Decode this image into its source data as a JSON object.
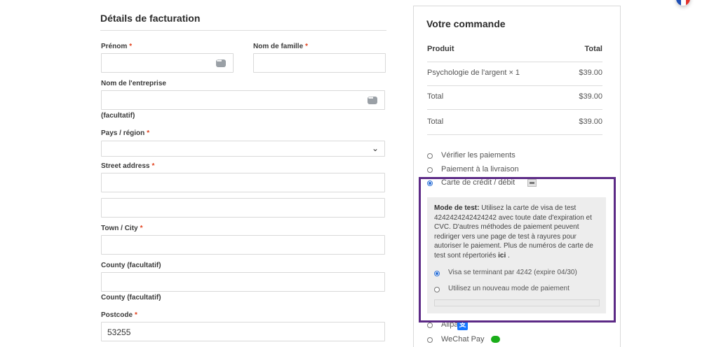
{
  "billing": {
    "title": "Détails de facturation",
    "required_mark": "*",
    "first_name": {
      "label": "Prénom",
      "value": ""
    },
    "last_name": {
      "label": "Nom de famille",
      "value": ""
    },
    "company": {
      "label": "Nom de l'entreprise",
      "hint": "(facultatif)",
      "value": ""
    },
    "country": {
      "label": "Pays / région",
      "value": ""
    },
    "street": {
      "label": "Street address",
      "value": "",
      "value2": ""
    },
    "town": {
      "label": "Town / City",
      "value": ""
    },
    "county": {
      "label": "County (facultatif)",
      "value": "",
      "hint": "County (facultatif)"
    },
    "postcode": {
      "label": "Postcode",
      "value": "53255"
    }
  },
  "order": {
    "title": "Votre commande",
    "head": {
      "product": "Produit",
      "total": "Total"
    },
    "rows": [
      {
        "label": "Psychologie de l'argent × 1",
        "amount": "$39.00"
      },
      {
        "label": "Total",
        "amount": "$39.00"
      },
      {
        "label": "Total",
        "amount": "$39.00"
      }
    ],
    "payment_methods": [
      {
        "label": "Vérifier les paiements",
        "selected": false
      },
      {
        "label": "Paiement à la livraison",
        "selected": false
      },
      {
        "label": "Carte de crédit / débit",
        "selected": true,
        "icon": "credit-card-icon"
      },
      {
        "label": "Alipay",
        "selected": false,
        "icon": "alipay-icon"
      },
      {
        "label": "WeChat Pay",
        "selected": false,
        "icon": "wechat-icon"
      }
    ],
    "test_mode": {
      "heading": "Mode de test:",
      "text": "Utilisez la carte de visa de test 4242424242424242 avec toute date d'expiration et CVC. D'autres méthodes de paiement peuvent rediriger vers une page de test à rayures pour autoriser le paiement. Plus de numéros de carte de test sont répertoriés",
      "link": "ici",
      "suffix": "."
    },
    "saved_card": "Visa se terminant par 4242 (expire 04/30)",
    "new_method": "Utilisez un nouveau mode de paiement"
  },
  "language": {
    "code": "FR",
    "caret": "⌄"
  },
  "colors": {
    "required": "#e2401c",
    "highlight": "#5c2a86",
    "radio": "#2a6fd6"
  }
}
